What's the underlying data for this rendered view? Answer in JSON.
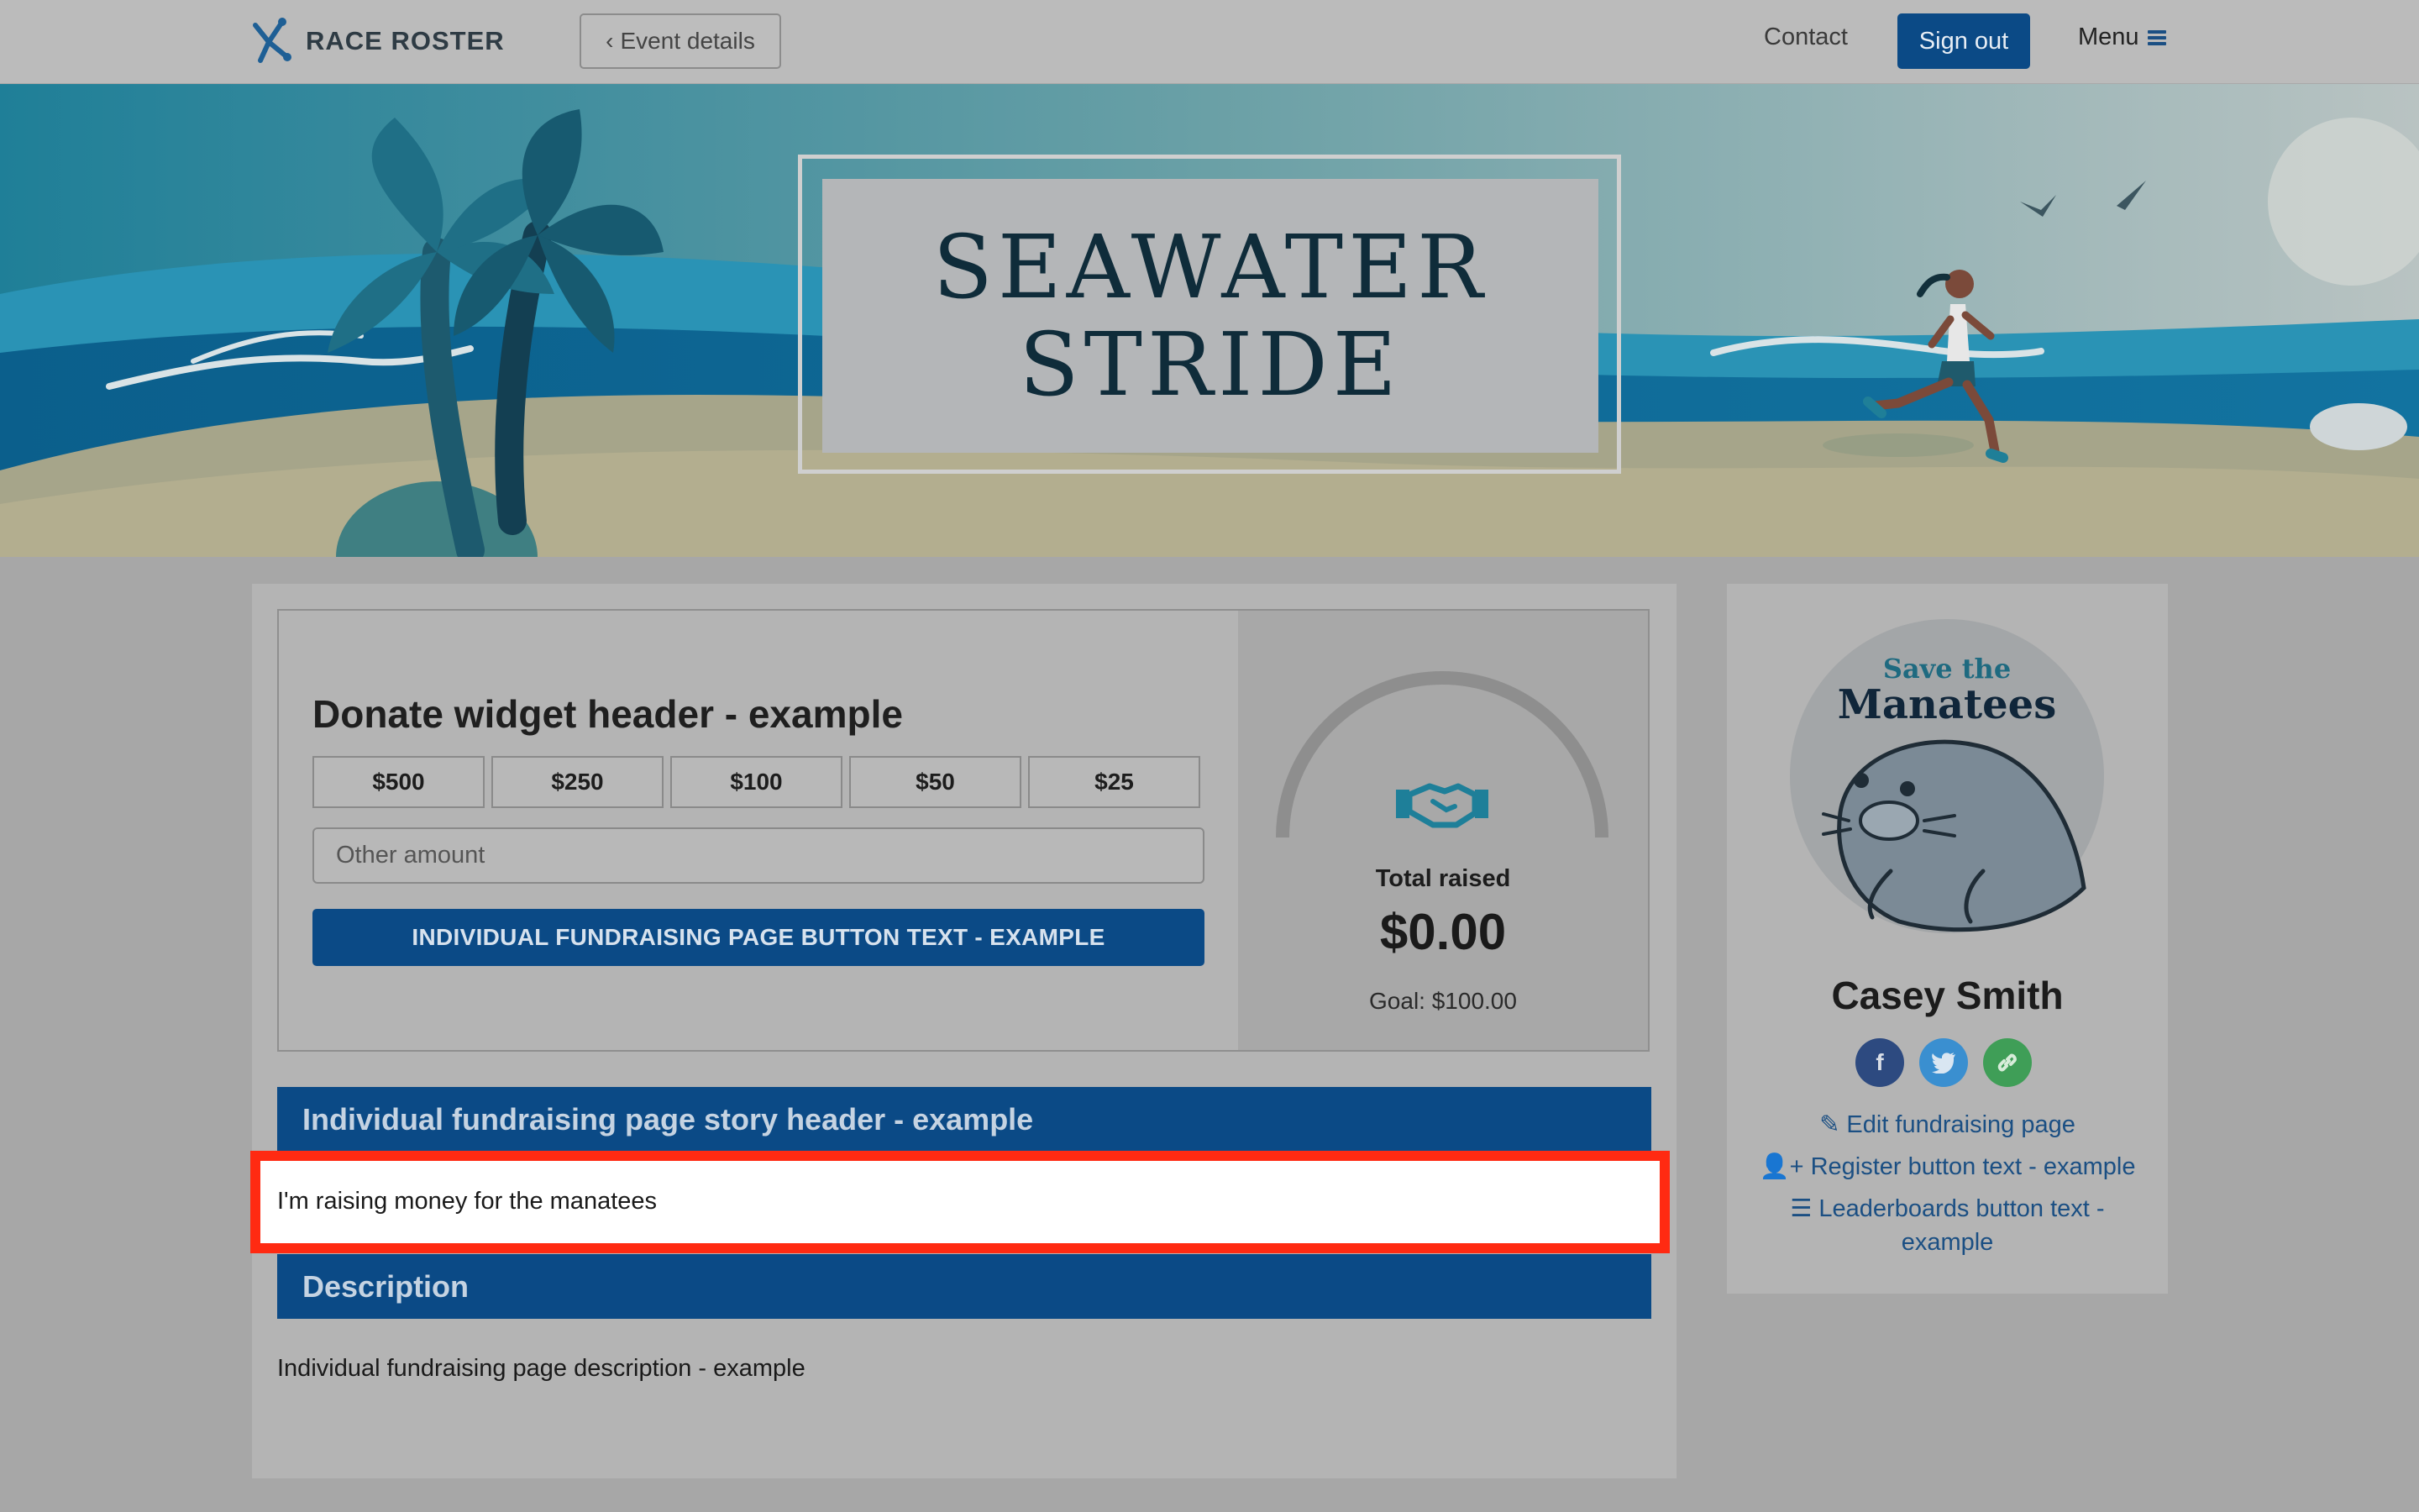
{
  "header": {
    "logo_text": "RACE ROSTER",
    "event_details_label": "Event details",
    "contact_label": "Contact",
    "signout_label": "Sign out",
    "menu_label": "Menu"
  },
  "hero": {
    "title_line1": "SEAWATER",
    "title_line2": "STRIDE"
  },
  "donate": {
    "header": "Donate widget header - example",
    "amounts": [
      "$500",
      "$250",
      "$100",
      "$50",
      "$25"
    ],
    "other_placeholder": "Other amount",
    "button_label": "INDIVIDUAL FUNDRAISING PAGE BUTTON TEXT - EXAMPLE",
    "total_label": "Total raised",
    "total_value": "$0.00",
    "goal": "Goal: $100.00",
    "progress_fraction": 0
  },
  "story": {
    "header": "Individual fundraising page story header - example",
    "text": "I'm raising money for the manatees"
  },
  "description": {
    "header": "Description",
    "text": "Individual fundraising page description - example"
  },
  "profile": {
    "avatar_line1": "Save the",
    "avatar_line2": "Manatees",
    "name": "Casey Smith",
    "edit_link": "Edit fundraising page",
    "register_link": "Register button text - example",
    "leaderboards_line1": "Leaderboards button text -",
    "leaderboards_line2": "example"
  },
  "colors": {
    "primary": "#0b4a86",
    "highlight_border": "#ff2a12",
    "facebook": "#2d4a80",
    "twitter": "#3a8fd0",
    "link": "#3f9e57"
  }
}
